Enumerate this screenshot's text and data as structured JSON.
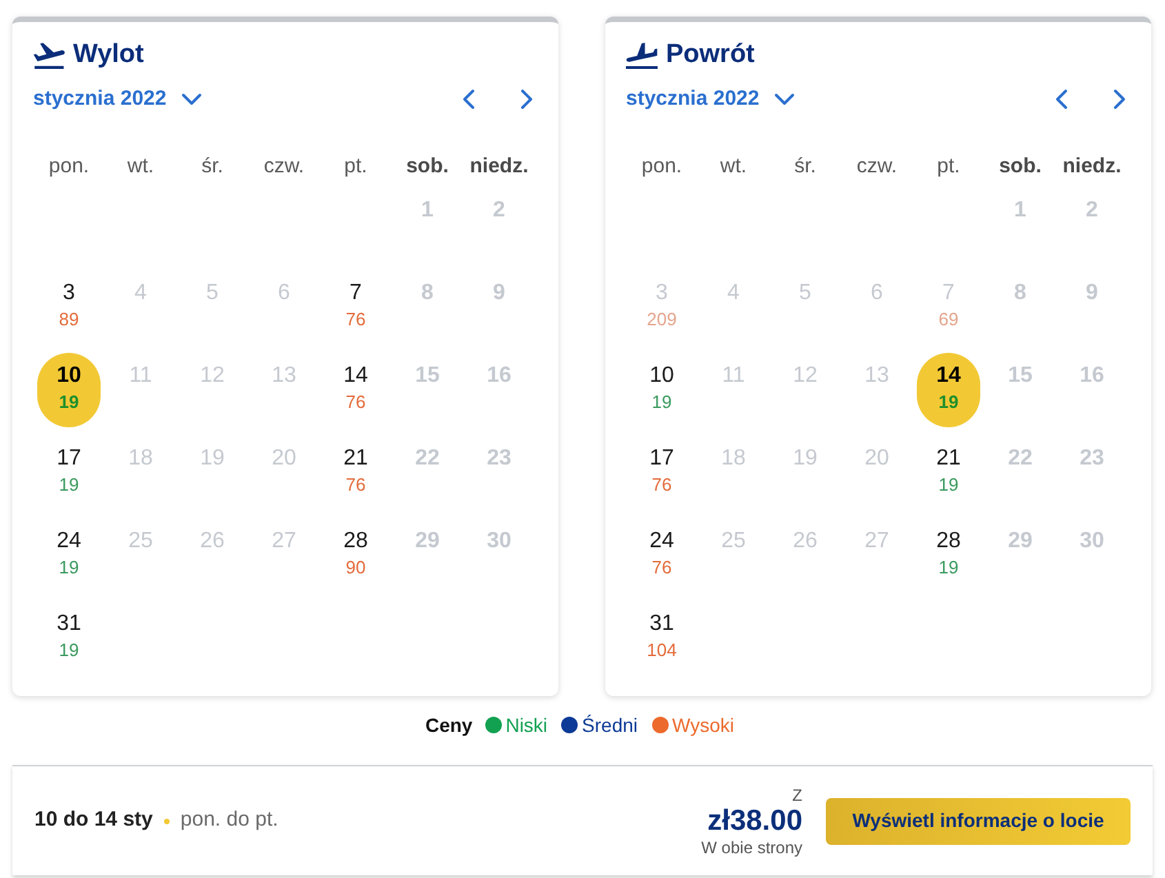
{
  "calendars": [
    {
      "kind": "departure",
      "title": "Wylot",
      "month": "stycznia 2022",
      "weekdays": [
        {
          "label": "pon.",
          "weekend": false
        },
        {
          "label": "wt.",
          "weekend": false
        },
        {
          "label": "śr.",
          "weekend": false
        },
        {
          "label": "czw.",
          "weekend": false
        },
        {
          "label": "pt.",
          "weekend": false
        },
        {
          "label": "sob.",
          "weekend": true
        },
        {
          "label": "niedz.",
          "weekend": true
        }
      ],
      "weeks": [
        [
          {
            "day": "1",
            "available": false,
            "selected": false
          },
          {
            "day": "2",
            "available": false,
            "selected": false
          }
        ],
        [
          {
            "day": "3",
            "available": true,
            "price": "89",
            "color": "#e36b3b",
            "selected": false
          },
          {
            "day": "4",
            "available": false,
            "selected": false
          },
          {
            "day": "5",
            "available": false,
            "selected": false
          },
          {
            "day": "6",
            "available": false,
            "selected": false
          },
          {
            "day": "7",
            "available": true,
            "price": "76",
            "color": "#e36b3b",
            "selected": false
          },
          {
            "day": "8",
            "available": false,
            "selected": false
          },
          {
            "day": "9",
            "available": false,
            "selected": false
          }
        ],
        [
          {
            "day": "10",
            "available": true,
            "price": "19",
            "color": "#1f8f2c",
            "selected": true
          },
          {
            "day": "11",
            "available": false,
            "selected": false
          },
          {
            "day": "12",
            "available": false,
            "selected": false
          },
          {
            "day": "13",
            "available": false,
            "selected": false
          },
          {
            "day": "14",
            "available": true,
            "price": "76",
            "color": "#e36b3b",
            "selected": false
          },
          {
            "day": "15",
            "available": false,
            "selected": false
          },
          {
            "day": "16",
            "available": false,
            "selected": false
          }
        ],
        [
          {
            "day": "17",
            "available": true,
            "price": "19",
            "color": "#3a9a5e",
            "selected": false
          },
          {
            "day": "18",
            "available": false,
            "selected": false
          },
          {
            "day": "19",
            "available": false,
            "selected": false
          },
          {
            "day": "20",
            "available": false,
            "selected": false
          },
          {
            "day": "21",
            "available": true,
            "price": "76",
            "color": "#e36b3b",
            "selected": false
          },
          {
            "day": "22",
            "available": false,
            "selected": false
          },
          {
            "day": "23",
            "available": false,
            "selected": false
          }
        ],
        [
          {
            "day": "24",
            "available": true,
            "price": "19",
            "color": "#3a9a5e",
            "selected": false
          },
          {
            "day": "25",
            "available": false,
            "selected": false
          },
          {
            "day": "26",
            "available": false,
            "selected": false
          },
          {
            "day": "27",
            "available": false,
            "selected": false
          },
          {
            "day": "28",
            "available": true,
            "price": "90",
            "color": "#e36b3b",
            "selected": false
          },
          {
            "day": "29",
            "available": false,
            "selected": false
          },
          {
            "day": "30",
            "available": false,
            "selected": false
          }
        ],
        [
          {
            "day": "31",
            "available": true,
            "price": "19",
            "color": "#3a9a5e",
            "selected": false
          }
        ]
      ]
    },
    {
      "kind": "return",
      "title": "Powrót",
      "month": "stycznia 2022",
      "weekdays": [
        {
          "label": "pon.",
          "weekend": false
        },
        {
          "label": "wt.",
          "weekend": false
        },
        {
          "label": "śr.",
          "weekend": false
        },
        {
          "label": "czw.",
          "weekend": false
        },
        {
          "label": "pt.",
          "weekend": false
        },
        {
          "label": "sob.",
          "weekend": true
        },
        {
          "label": "niedz.",
          "weekend": true
        }
      ],
      "weeks": [
        [
          {
            "day": "1",
            "available": false,
            "selected": false
          },
          {
            "day": "2",
            "available": false,
            "selected": false
          }
        ],
        [
          {
            "day": "3",
            "available": false,
            "price": "209",
            "color": "#e4a58d",
            "selected": false
          },
          {
            "day": "4",
            "available": false,
            "selected": false
          },
          {
            "day": "5",
            "available": false,
            "selected": false
          },
          {
            "day": "6",
            "available": false,
            "selected": false
          },
          {
            "day": "7",
            "available": false,
            "price": "69",
            "color": "#e4a58d",
            "selected": false
          },
          {
            "day": "8",
            "available": false,
            "selected": false
          },
          {
            "day": "9",
            "available": false,
            "selected": false
          }
        ],
        [
          {
            "day": "10",
            "available": true,
            "price": "19",
            "color": "#3a9a5e",
            "selected": false
          },
          {
            "day": "11",
            "available": false,
            "selected": false
          },
          {
            "day": "12",
            "available": false,
            "selected": false
          },
          {
            "day": "13",
            "available": false,
            "selected": false
          },
          {
            "day": "14",
            "available": true,
            "price": "19",
            "color": "#1f8f2c",
            "selected": true
          },
          {
            "day": "15",
            "available": false,
            "selected": false
          },
          {
            "day": "16",
            "available": false,
            "selected": false
          }
        ],
        [
          {
            "day": "17",
            "available": true,
            "price": "76",
            "color": "#e36b3b",
            "selected": false
          },
          {
            "day": "18",
            "available": false,
            "selected": false
          },
          {
            "day": "19",
            "available": false,
            "selected": false
          },
          {
            "day": "20",
            "available": false,
            "selected": false
          },
          {
            "day": "21",
            "available": true,
            "price": "19",
            "color": "#3a9a5e",
            "selected": false
          },
          {
            "day": "22",
            "available": false,
            "selected": false
          },
          {
            "day": "23",
            "available": false,
            "selected": false
          }
        ],
        [
          {
            "day": "24",
            "available": true,
            "price": "76",
            "color": "#e36b3b",
            "selected": false
          },
          {
            "day": "25",
            "available": false,
            "selected": false
          },
          {
            "day": "26",
            "available": false,
            "selected": false
          },
          {
            "day": "27",
            "available": false,
            "selected": false
          },
          {
            "day": "28",
            "available": true,
            "price": "19",
            "color": "#3a9a5e",
            "selected": false
          },
          {
            "day": "29",
            "available": false,
            "selected": false
          },
          {
            "day": "30",
            "available": false,
            "selected": false
          }
        ],
        [
          {
            "day": "31",
            "available": true,
            "price": "104",
            "color": "#e36b3b",
            "selected": false
          }
        ]
      ]
    }
  ],
  "legend": {
    "title": "Ceny",
    "items": [
      {
        "label": "Niski",
        "color": "#12a150"
      },
      {
        "label": "Średni",
        "color": "#0c3a96"
      },
      {
        "label": "Wysoki",
        "color": "#ec6a2c"
      }
    ]
  },
  "summary": {
    "dates": "10 do 14 sty",
    "days": "pon. do pt.",
    "price_prefix": "Z",
    "price": "zł38.00",
    "price_note": "W obie strony",
    "button": "Wyświetl informacje o locie"
  }
}
